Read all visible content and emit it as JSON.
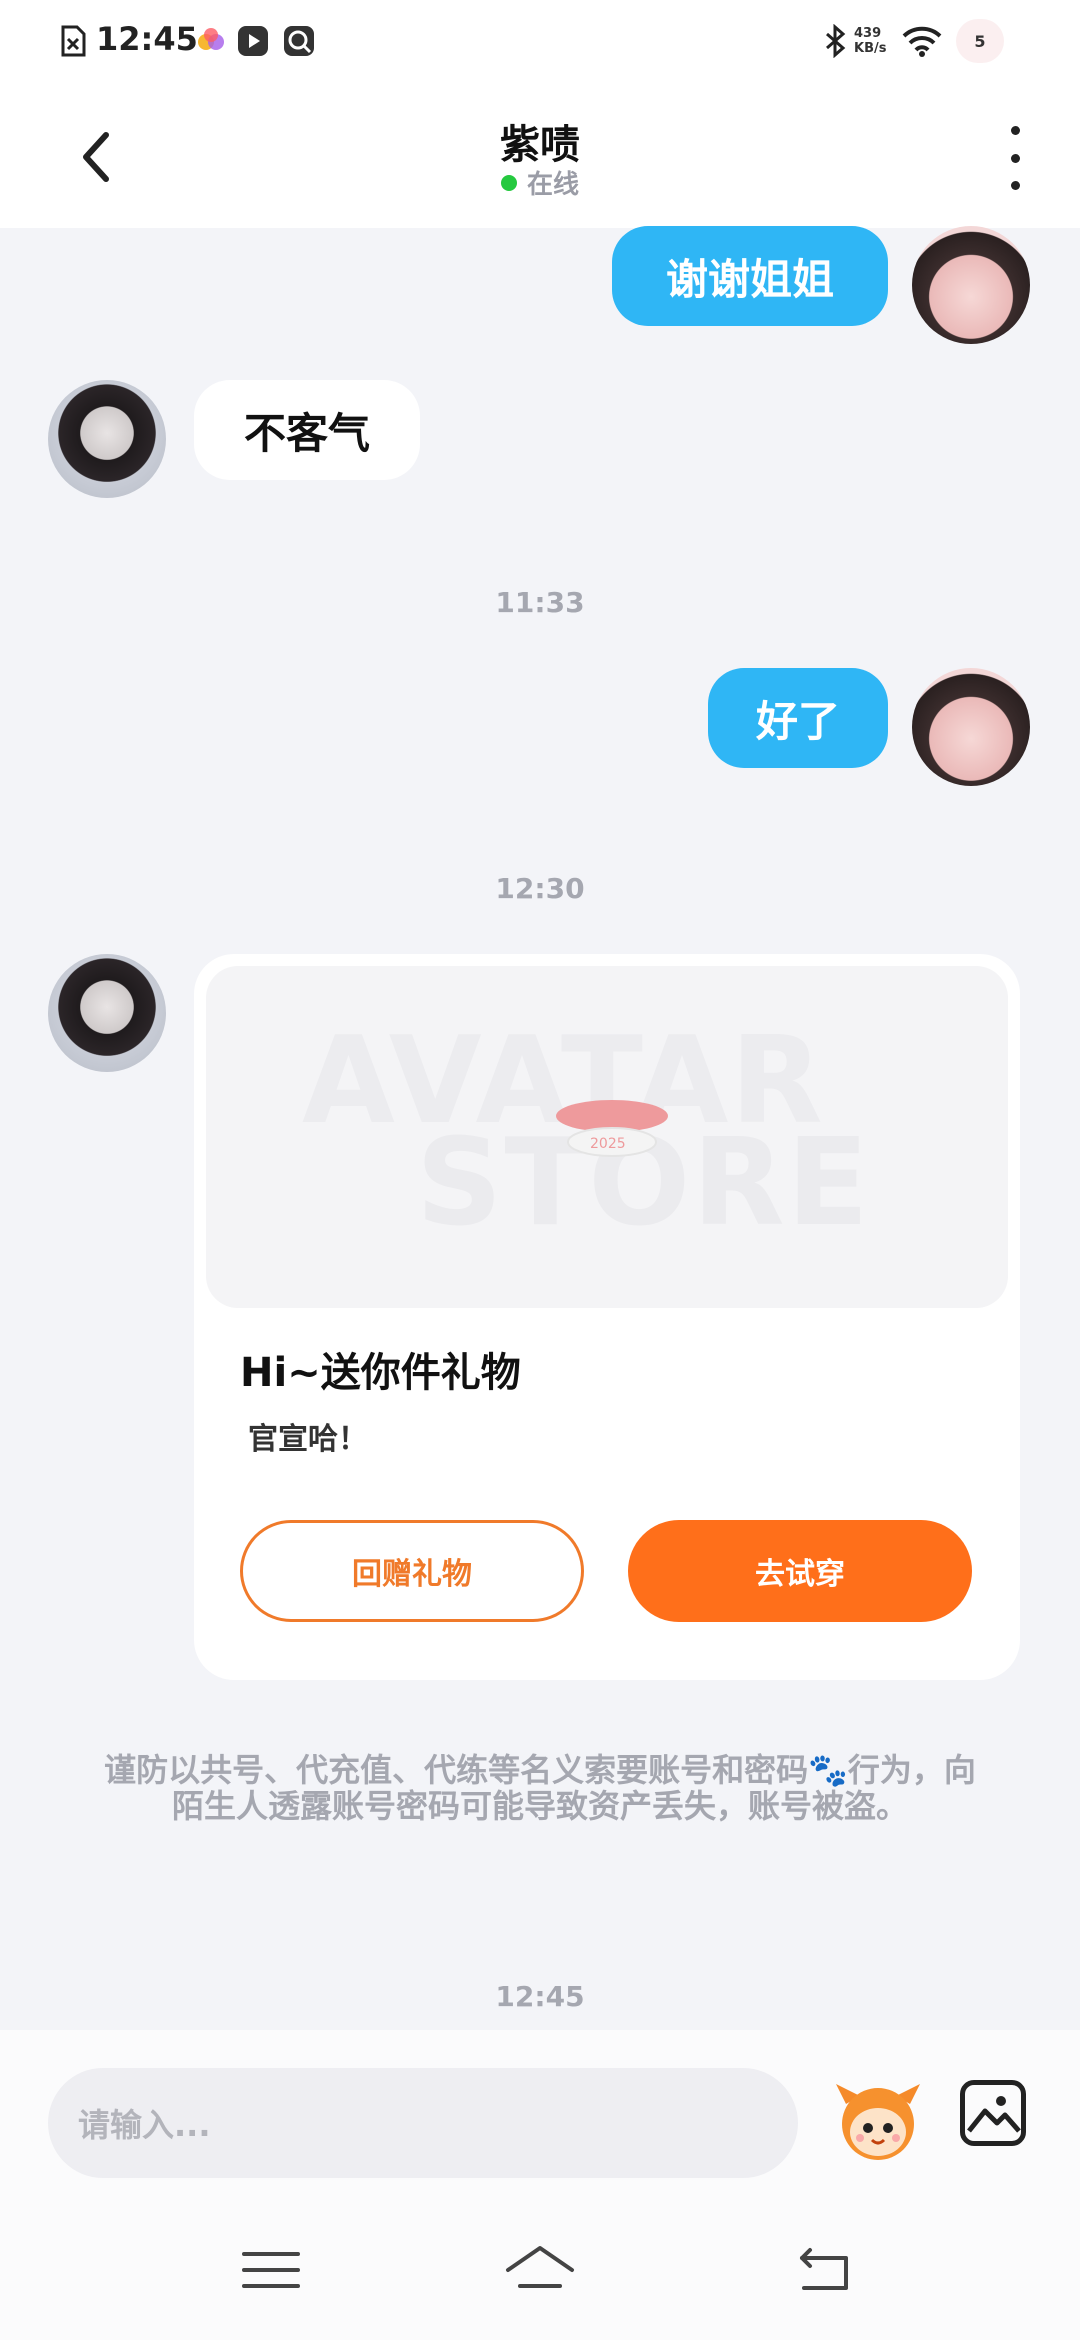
{
  "status_bar": {
    "time": "12:45",
    "network_speed_value": "439",
    "network_speed_unit": "KB/s",
    "battery": "5",
    "icons": [
      "file-x-icon",
      "app-colorful-icon",
      "play-icon",
      "search-app-icon",
      "bluetooth-icon",
      "wifi-icon",
      "battery-icon"
    ]
  },
  "header": {
    "title": "紫啧",
    "status": "在线"
  },
  "messages": [
    {
      "side": "out",
      "text": "谢谢姐姐"
    },
    {
      "side": "in",
      "text": "不客气"
    },
    {
      "type": "timestamp",
      "text": "11:33"
    },
    {
      "side": "out",
      "text": "好了"
    },
    {
      "type": "timestamp",
      "text": "12:30"
    }
  ],
  "gift_card": {
    "watermark_line1": "AVATAR",
    "watermark_line2": "STORE",
    "item_label": "2025",
    "title": "Hi~送你件礼物",
    "subtitle": "官宣哈！",
    "return_gift_label": "回赠礼物",
    "try_on_label": "去试穿"
  },
  "warning": "谨防以共号、代充值、代练等名义索要账号和密码🐾行为，向陌生人透露账号密码可能导致资产丢失，账号被盗。",
  "last_timestamp": "12:45",
  "input": {
    "placeholder": "请输入..."
  },
  "colors": {
    "outgoing_bubble": "#2fb6f5",
    "accent_orange": "#ff6f1a",
    "online": "#25c93f"
  }
}
